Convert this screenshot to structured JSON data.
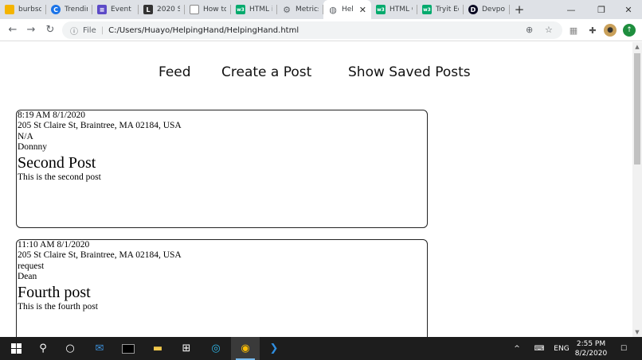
{
  "browser": {
    "tabs": [
      {
        "title": "burbsd",
        "favicon_color": "#f4b400",
        "icon": "flame-icon"
      },
      {
        "title": "Trendin",
        "favicon_color": "#1a73e8",
        "icon": "c-logo-icon"
      },
      {
        "title": "Event n",
        "favicon_color": "#5c4ac7",
        "icon": "list-icon"
      },
      {
        "title": "2020 S",
        "favicon_color": "#333333",
        "icon": "l-logo-icon"
      },
      {
        "title": "How to",
        "favicon_color": "#888888",
        "icon": "page-icon"
      },
      {
        "title": "HTML i",
        "favicon_color": "#04aa6d",
        "icon": "w3-icon"
      },
      {
        "title": "Metrics",
        "favicon_color": "#5f6368",
        "icon": "gear-icon"
      },
      {
        "title": "Hel",
        "favicon_color": "#5f6368",
        "icon": "globe-icon",
        "active": true
      },
      {
        "title": "HTML C",
        "favicon_color": "#04aa6d",
        "icon": "w3-icon"
      },
      {
        "title": "Tryit Ed",
        "favicon_color": "#04aa6d",
        "icon": "w3-icon"
      },
      {
        "title": "Devpo",
        "favicon_color": "#0a0a23",
        "icon": "d-logo-icon"
      }
    ],
    "tab_close_glyph": "✕",
    "new_tab_glyph": "+",
    "address": {
      "scheme_label": "File",
      "url": "C:/Users/Huayo/HelpingHand/HelpingHand.html"
    }
  },
  "site_nav": {
    "feed": "Feed",
    "create": "Create a Post",
    "saved": "Show Saved Posts"
  },
  "posts": [
    {
      "time": "8:19 AM 8/1/2020",
      "address": "205 St Claire St, Braintree, MA 02184, USA",
      "type": "N/A",
      "author": "Donnny",
      "title": "Second Post",
      "body": "This is the second post"
    },
    {
      "time": "11:10 AM 8/1/2020",
      "address": "205 St Claire St, Braintree, MA 02184, USA",
      "type": "request",
      "author": "Dean",
      "title": "Fourth post",
      "body": "This is the fourth post"
    }
  ],
  "taskbar": {
    "language": "ENG",
    "time": "2:55 PM",
    "date": "8/2/2020"
  }
}
